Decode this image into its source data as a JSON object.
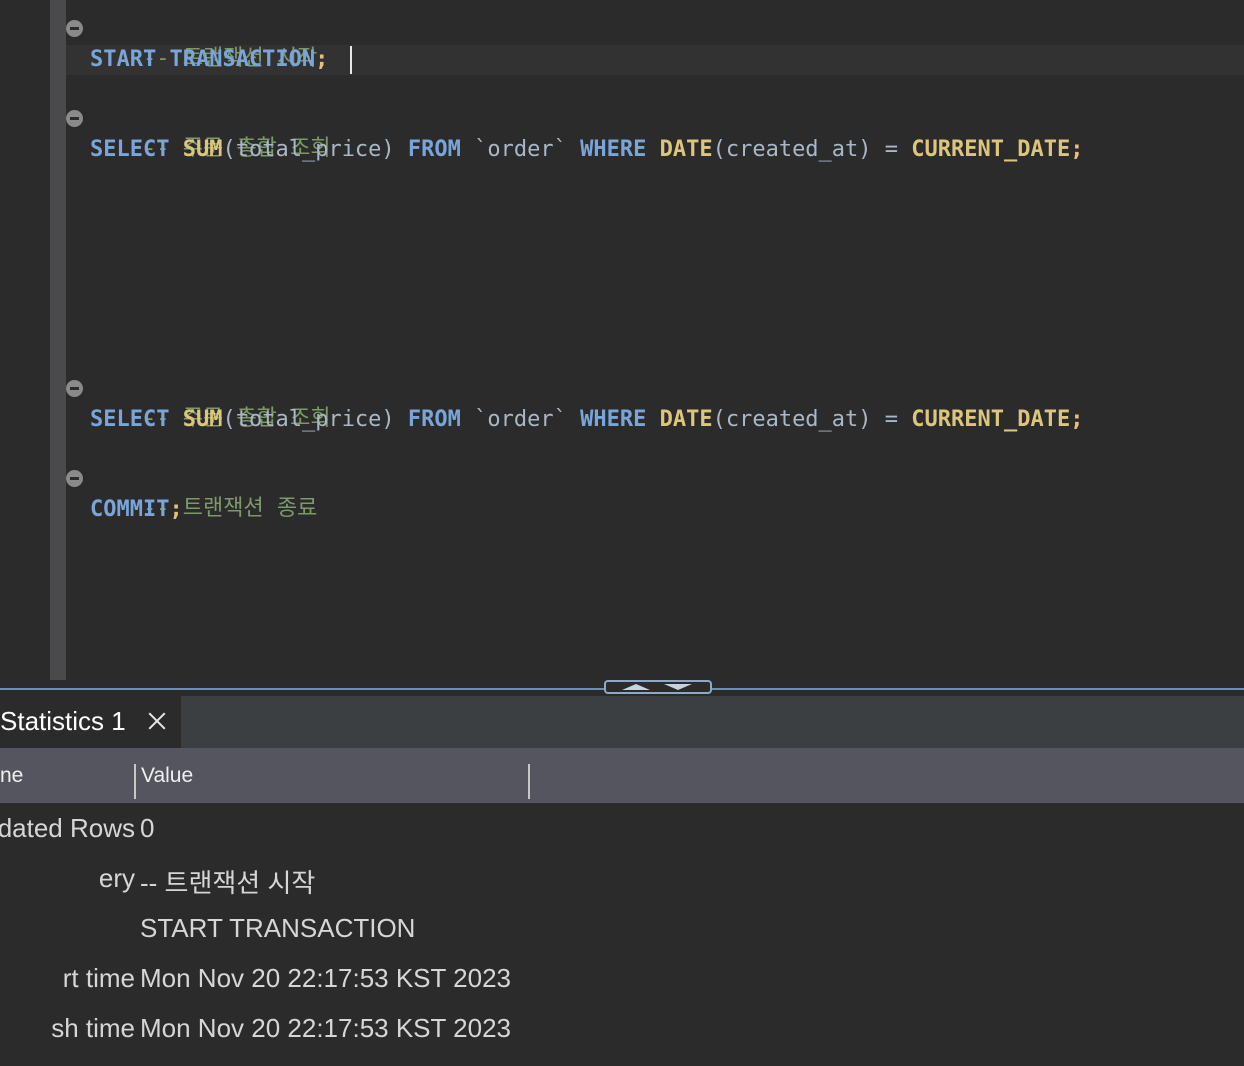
{
  "editor": {
    "lines": {
      "comment1": "-- 트랜잭션 시작",
      "start_kw": "START TRANSACTION",
      "start_semi": ";",
      "comment2": "-- 주문 총합 조회",
      "select_kw": "SELECT",
      "sum_fn": "SUM",
      "sum_arg": "(total_price) ",
      "from_kw": "FROM",
      "table_name": " `order` ",
      "where_kw": "WHERE",
      "date_fn": "DATE",
      "date_arg": "(created_at) = ",
      "current_date": "CURRENT_DATE",
      "semi": ";",
      "comment3": "-- 주문 총합 조회",
      "comment4": "-- 트랜잭션 종료",
      "commit_kw": "COMMIT",
      "commit_semi": ";"
    }
  },
  "results": {
    "tab_label": "Statistics 1",
    "columns": [
      "ne",
      "Value"
    ],
    "rows": [
      {
        "name": "dated Rows",
        "value": "0"
      },
      {
        "name": "ery",
        "value": "-- 트랜잭션 시작"
      },
      {
        "name": "",
        "value": "START TRANSACTION"
      },
      {
        "name": "rt time",
        "value": "Mon Nov 20 22:17:53 KST 2023"
      },
      {
        "name": "sh time",
        "value": "Mon Nov 20 22:17:53 KST 2023"
      }
    ]
  },
  "colors": {
    "editor_bg": "#2b2b2b",
    "keyword": "#7aa5d9",
    "function": "#dcc57c",
    "comment": "#7c9a68",
    "header_bg": "#55555f"
  }
}
